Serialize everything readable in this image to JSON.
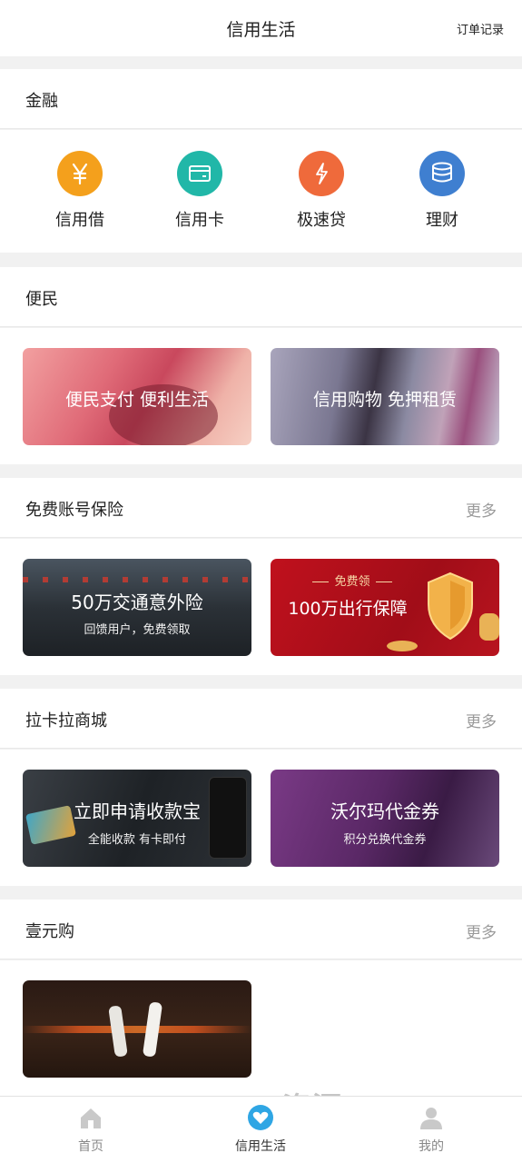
{
  "header": {
    "title": "信用生活",
    "orders_link": "订单记录"
  },
  "finance": {
    "title": "金融",
    "items": [
      {
        "label": "信用借",
        "icon": "yen-icon",
        "color": "#f4a01c"
      },
      {
        "label": "信用卡",
        "icon": "card-icon",
        "color": "#21b7a8"
      },
      {
        "label": "极速贷",
        "icon": "lightning-icon",
        "color": "#ef6a3b"
      },
      {
        "label": "理财",
        "icon": "coins-icon",
        "color": "#3f7fd0"
      }
    ]
  },
  "convenience": {
    "title": "便民",
    "banners": [
      {
        "text": "便民支付  便利生活"
      },
      {
        "text": "信用购物  免押租赁"
      }
    ]
  },
  "insurance": {
    "title": "免费账号保险",
    "more": "更多",
    "banners": [
      {
        "title": "50万交通意外险",
        "subtitle": "回馈用户，免费领取"
      },
      {
        "tag": "免费领",
        "title": "100万出行保障"
      }
    ]
  },
  "mall": {
    "title": "拉卡拉商城",
    "more": "更多",
    "banners": [
      {
        "title": "立即申请收款宝",
        "subtitle": "全能收款 有卡即付"
      },
      {
        "title": "沃尔玛代金券",
        "subtitle": "积分兑换代金券"
      }
    ]
  },
  "onebuy": {
    "title": "壹元购",
    "more": "更多"
  },
  "tabbar": {
    "items": [
      {
        "label": "首页",
        "icon": "home-icon"
      },
      {
        "label": "信用生活",
        "icon": "heart-icon",
        "active": true
      },
      {
        "label": "我的",
        "icon": "person-icon"
      }
    ]
  },
  "watermark": "BOSS 资源"
}
